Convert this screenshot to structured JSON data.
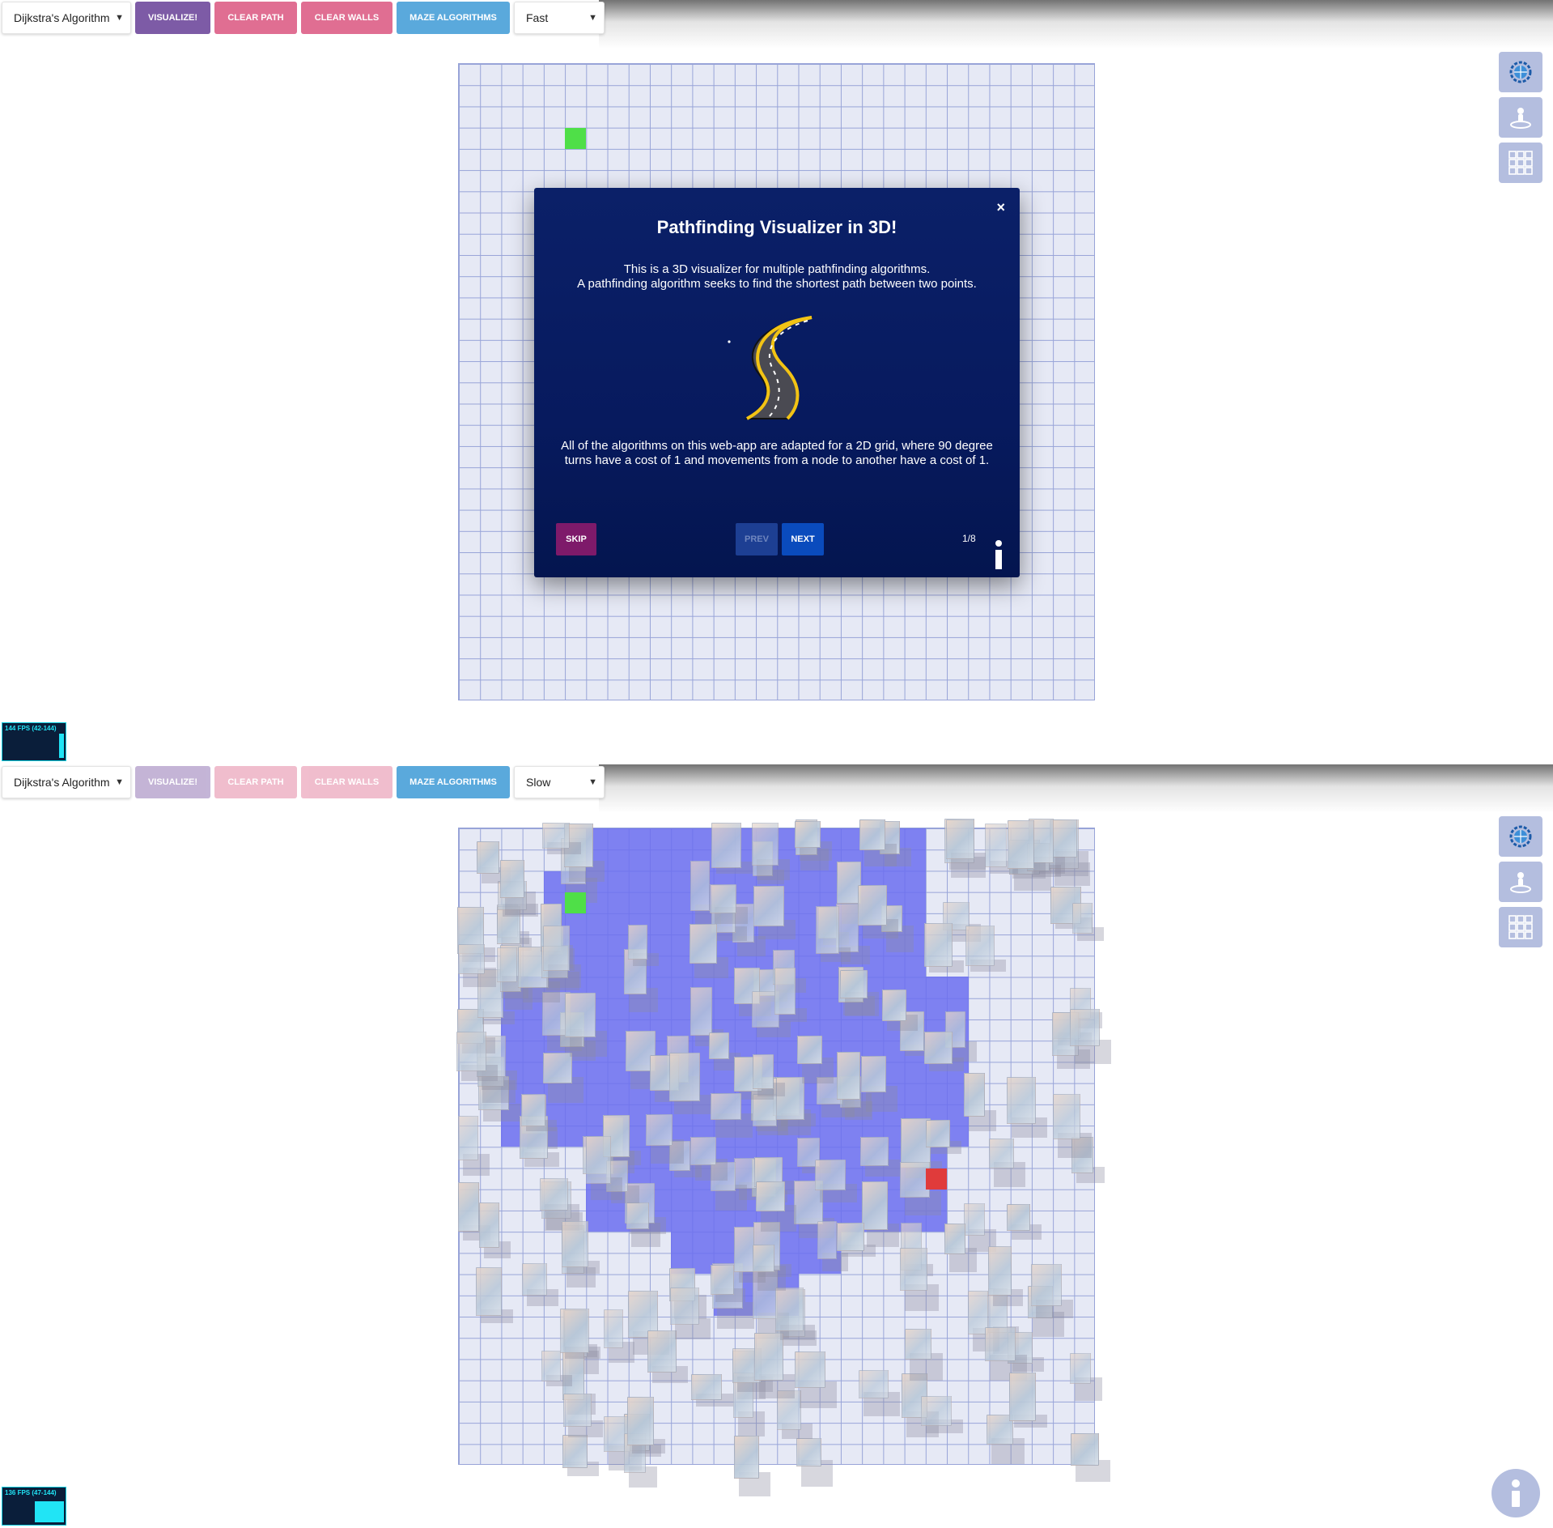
{
  "app": {
    "algorithm_select": "Dijkstra's Algorithm",
    "visualize_label": "VISUALIZE!",
    "clear_path_label": "CLEAR PATH",
    "clear_walls_label": "CLEAR WALLS",
    "maze_label": "MAZE ALGORITHMS"
  },
  "panel1": {
    "speed": "Fast",
    "fps_label": "144 FPS (42-144)",
    "modal": {
      "title": "Pathfinding Visualizer in 3D!",
      "intro_line1": "This is a 3D visualizer for multiple pathfinding algorithms.",
      "intro_line2": "A pathfinding algorithm seeks to find the shortest path between two points.",
      "body": "All of the algorithms on this web-app are adapted for a 2D grid, where 90 degree turns have a cost of 1 and movements from a node to another have a cost of 1.",
      "skip_label": "SKIP",
      "prev_label": "PREV",
      "next_label": "NEXT",
      "step": "1/8",
      "close_glyph": "×"
    }
  },
  "panel2": {
    "speed": "Slow",
    "fps_label": "136 FPS (47-144)"
  },
  "icons": [
    "globe-gear-icon",
    "person-icon",
    "grid-icon",
    "info-icon",
    "road-icon",
    "close-icon"
  ],
  "colors": {
    "visualize": "#7d5ba6",
    "clear": "#e06e92",
    "maze": "#5aa9dc",
    "modal_bg": "#071a5e",
    "start_node": "#4fdf48",
    "end_node": "#e03b3b",
    "visited": "#6b6ef0"
  }
}
